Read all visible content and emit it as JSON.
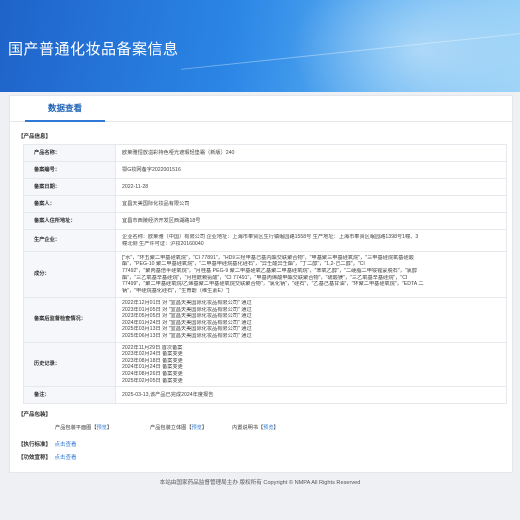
{
  "header": {
    "title": "国产普通化妆品备案信息"
  },
  "tab": {
    "label": "数据查看"
  },
  "sections": {
    "product_info": "【产品信息】",
    "package": "【产品包装】",
    "standard": "【执行标准】",
    "efficacy": "【功效宣称】"
  },
  "rows": {
    "product_name": {
      "label": "产品名称：",
      "value": "欧莱雅恒放溢彩持色哑光遮瑕轻垫霜（新版）240"
    },
    "record_no": {
      "label": "备案编号：",
      "value": "鄂G妆网备字2022001516"
    },
    "record_date": {
      "label": "备案日期：",
      "value": "2022-11-28"
    },
    "filer": {
      "label": "备案人：",
      "value": "宜昌天美国际化妆品有限公司"
    },
    "filer_address": {
      "label": "备案人住所地址：",
      "value": "宜昌市西陵经济开发区西湖路18号"
    },
    "manufacturer": {
      "label": "生产企业：",
      "lines": [
        "企业名称：欧莱雅（中国）有限公司 企业地址：上海市奉贤区生行镇岷园路1558号 生产地址：上海市奉贤区岷园路1398号1幢、3",
        "幢北侧 生产许可证：沪妆20160040"
      ]
    },
    "ingredients": {
      "label": "成分：",
      "lines": [
        "[\"水\"，\"环五聚二甲基硅氧烷\"，\"CI 77891\"，\"HDI/三羟甲基己基内酯交联聚合物\"，\"甲基聚三甲基硅氧烷\"，\"三甲基硅烷氧基硅酸",
        "酯\"，\"PEG-10 聚二甲基硅氧烷\"，\"二甲基甲硅烷基化硅石\"，\"异壬酸异壬酯\"，\"丁二醇\"，\"1,2-己二醇\"，\"CI",
        "77492\"，\"聚丙基倍半硅氧烷\"，\"月桂基 PEG-9 聚二甲基硅氧乙基聚二甲基硅氧烷\"，\"苯氧乙醇\"，\"二硬脂二甲铵锂蒙脱石\"，\"氯醇",
        "酯\"，\"三乙氧基辛基硅烷\"，\"月桂酰赖氨酸\"，\"CI 77491\"，\"甲基丙烯酸甲酯交联聚合物\"，\"硫酸镁\"，\"三乙氧基辛基硅烷\"，\"CI",
        "77499\"，\"聚二甲基硅氧烷/乙烯基聚二甲基硅氧烷交联聚合物\"，\"氯化钠\"，\"硅石\"，\"乙基己基甘油\"，\"环聚二甲基硅氧烷\"，\"EDTA 二",
        "钠\"，\"甲硅烷基化硅石\"，\"生育酚（维生素E）\"]"
      ]
    },
    "inspection": {
      "label": "备案后监督检查情况：",
      "lines": [
        "2022年12月01日 对 \"宜昌天美国际化妆品有限公司\" 通过",
        "2023年01月05日 对 \"宜昌天美国际化妆品有限公司\" 通过",
        "2023年05月05日 对 \"宜昌天美国际化妆品有限公司\" 通过",
        "2024年01月24日 对 \"宜昌天美国际化妆品有限公司\" 通过",
        "2025年03月13日 对 \"宜昌天美国际化妆品有限公司\" 通过",
        "2025年06月13日 对 \"宜昌天美国际化妆品有限公司\" 通过"
      ]
    },
    "history": {
      "label": "历史记录：",
      "lines": [
        "2022年11月29日 首次备案",
        "2023年02月24日 备案变更",
        "2023年08月18日 备案变更",
        "2024年01月24日 备案变更",
        "2024年08月26日 备案变更",
        "2025年02月05日 备案变更"
      ]
    },
    "note": {
      "label": "备注：",
      "value": "2025-03-13,该产品已完成2024年度报告"
    }
  },
  "package": {
    "flat_label": "产品包装平面图【",
    "flat_link": "预览",
    "flat_close": "】",
    "solid_label": "产品包装立体图【",
    "solid_link": "预览",
    "solid_close": "】",
    "manual_label": "内置说明书【",
    "manual_link": "预览",
    "manual_close": "】"
  },
  "standard": {
    "link": "点击查看"
  },
  "efficacy": {
    "link": "点击查看"
  },
  "footer": {
    "text": "本站由国家药品监督管理局主办 版权所有 Copyright © NMPA All Rights Reserved"
  }
}
